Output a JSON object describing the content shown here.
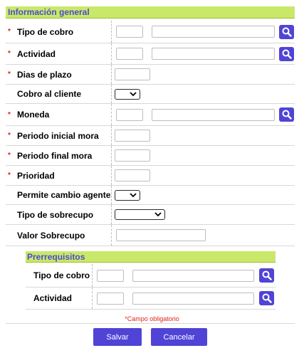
{
  "section": {
    "title": "Información general"
  },
  "required_mark": "*",
  "fields": {
    "tipo_cobro": {
      "label": "Tipo de cobro",
      "code": "",
      "desc": ""
    },
    "actividad": {
      "label": "Actividad",
      "code": "",
      "desc": ""
    },
    "dias_plazo": {
      "label": "Dias de plazo",
      "value": ""
    },
    "cobro_cliente": {
      "label": "Cobro al cliente",
      "selected": ""
    },
    "moneda": {
      "label": "Moneda",
      "code": "",
      "desc": ""
    },
    "periodo_inicial": {
      "label": "Periodo inicial mora",
      "value": ""
    },
    "periodo_final": {
      "label": "Periodo final mora",
      "value": ""
    },
    "prioridad": {
      "label": "Prioridad",
      "value": ""
    },
    "permite_cambio": {
      "label": "Permite cambio agente",
      "selected": ""
    },
    "tipo_sobrecupo": {
      "label": "Tipo de sobrecupo",
      "selected": ""
    },
    "valor_sobrecupo": {
      "label": "Valor Sobrecupo",
      "value": ""
    }
  },
  "prerequisites": {
    "title": "Prerrequisitos",
    "tipo_cobro": {
      "label": "Tipo de cobro",
      "code": "",
      "desc": ""
    },
    "actividad": {
      "label": "Actividad",
      "code": "",
      "desc": ""
    }
  },
  "required_note": "*Campo obligatorio",
  "buttons": {
    "save": "Salvar",
    "cancel": "Cancelar"
  },
  "icons": {
    "search": "search-icon",
    "dropdown": "chevron-down-icon"
  },
  "colors": {
    "header_bg": "#c9e86a",
    "header_text": "#4a4acf",
    "button": "#5044d6",
    "required": "#e0231c"
  }
}
